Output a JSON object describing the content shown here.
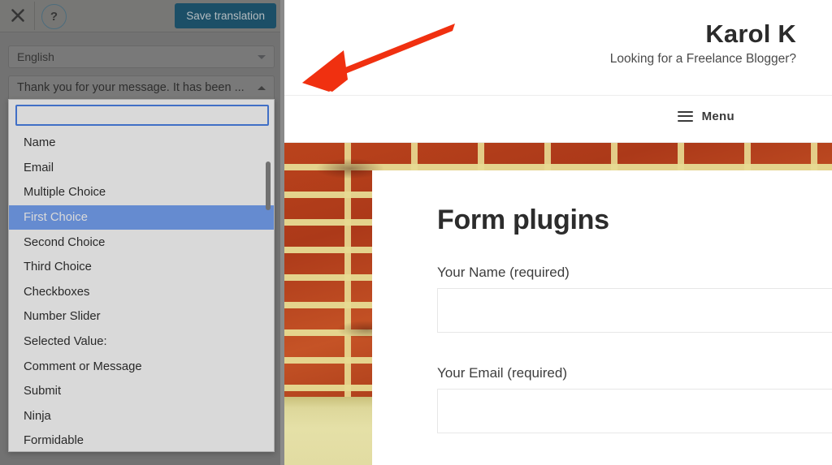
{
  "panel": {
    "toolbar": {
      "close_icon": "close-icon",
      "help_icon": "help-circle-icon",
      "help_glyph": "?",
      "save_label": "Save translation",
      "save_bg": "#0e4f6e"
    },
    "language_select": {
      "value": "English",
      "caret_icon": "chevron-down-icon"
    },
    "string_select": {
      "value": "Thank you for your message. It has been ...",
      "caret_icon": "chevron-up-icon"
    },
    "dropdown": {
      "search_value": "",
      "search_placeholder": "",
      "highlight_color": "#6b9bf4",
      "selected_index": 3,
      "items": [
        {
          "label": "Name"
        },
        {
          "label": "Email"
        },
        {
          "label": "Multiple Choice"
        },
        {
          "label": "First Choice"
        },
        {
          "label": "Second Choice"
        },
        {
          "label": "Third Choice"
        },
        {
          "label": "Checkboxes"
        },
        {
          "label": "Number Slider"
        },
        {
          "label": "Selected Value:"
        },
        {
          "label": "Comment or Message"
        },
        {
          "label": "Submit"
        },
        {
          "label": "Ninja"
        },
        {
          "label": "Formidable"
        }
      ]
    }
  },
  "site": {
    "title": "Karol K",
    "tagline": "Looking for a Freelance Blogger?",
    "nav": {
      "menu_label": "Menu",
      "menu_icon": "hamburger-icon"
    },
    "article": {
      "heading": "Form plugins",
      "fields": [
        {
          "label": "Your Name (required)",
          "value": "",
          "placeholder": ""
        },
        {
          "label": "Your Email (required)",
          "value": "",
          "placeholder": ""
        }
      ]
    }
  },
  "annotation": {
    "arrow_icon": "arrow-pointing-left-icon",
    "arrow_color": "#F03010"
  }
}
